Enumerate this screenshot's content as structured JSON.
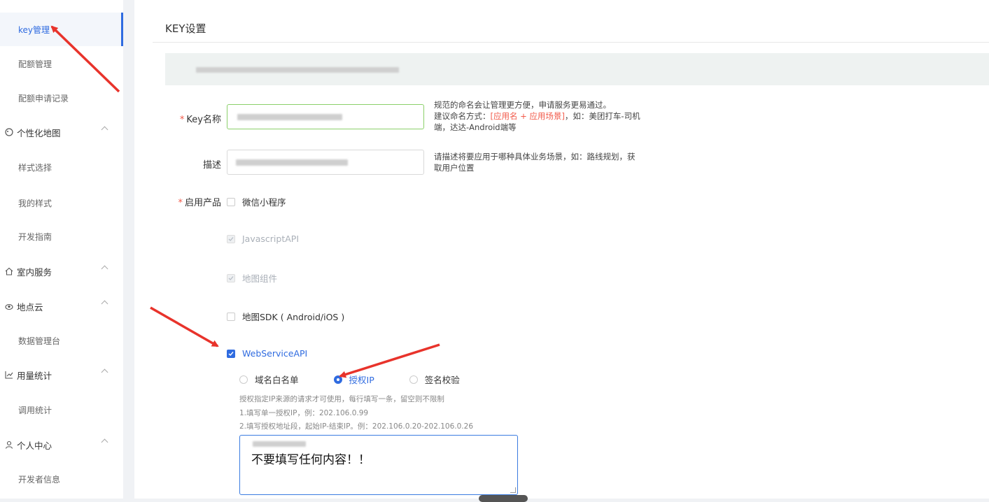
{
  "sidebar": {
    "items": [
      {
        "label": "key管理",
        "type": "sub",
        "active": true
      },
      {
        "label": "配额管理",
        "type": "sub"
      },
      {
        "label": "配额申请记录",
        "type": "sub"
      },
      {
        "label": "个性化地图",
        "type": "group",
        "icon": "paint-icon"
      },
      {
        "label": "样式选择",
        "type": "sub"
      },
      {
        "label": "我的样式",
        "type": "sub"
      },
      {
        "label": "开发指南",
        "type": "sub"
      },
      {
        "label": "室内服务",
        "type": "group",
        "icon": "home-icon"
      },
      {
        "label": "地点云",
        "type": "group",
        "icon": "cloud-icon"
      },
      {
        "label": "数据管理台",
        "type": "sub"
      },
      {
        "label": "用量统计",
        "type": "group",
        "icon": "chart-icon"
      },
      {
        "label": "调用统计",
        "type": "sub"
      },
      {
        "label": "个人中心",
        "type": "group",
        "icon": "user-icon"
      },
      {
        "label": "开发者信息",
        "type": "sub"
      }
    ]
  },
  "page": {
    "title": "KEY设置"
  },
  "form": {
    "key_name": {
      "label": "Key名称",
      "required_mark": "*",
      "hint1": "规范的命名会让管理更方便，申请服务更易通过。",
      "hint2a": "建议命名方式：",
      "hint2b": "[应用名 + 应用场景]",
      "hint2c": "，如：美团打车-司机",
      "hint3": "端，达达-Android端等"
    },
    "description": {
      "label": "描述",
      "hint1": "请描述将要应用于哪种具体业务场景，如：路线规划，获",
      "hint2": "取用户位置"
    },
    "products": {
      "label": "启用产品",
      "required_mark": "*",
      "options": [
        {
          "label": "微信小程序",
          "state": "unchecked"
        },
        {
          "label": "JavascriptAPI",
          "state": "disabled-checked"
        },
        {
          "label": "地图组件",
          "state": "disabled-checked"
        },
        {
          "label": "地图SDK ( Android/iOS )",
          "state": "unchecked"
        },
        {
          "label": "WebServiceAPI",
          "state": "checked"
        }
      ]
    },
    "webservice": {
      "radios": [
        {
          "label": "域名白名单",
          "selected": false
        },
        {
          "label": "授权IP",
          "selected": true
        },
        {
          "label": "签名校验",
          "selected": false
        }
      ],
      "help1": "授权指定IP来源的请求才可使用，每行填写一条，留空则不限制",
      "help2": "1.填写单一授权IP，例：202.106.0.99",
      "help3": "2.填写授权地址段，起始IP-结束IP。例：202.106.0.20-202.106.0.26",
      "textarea_note": "不要填写任何内容！！"
    }
  },
  "colors": {
    "accent": "#2f6be0",
    "required": "#f25a4a",
    "annotation": "#e8332b"
  }
}
